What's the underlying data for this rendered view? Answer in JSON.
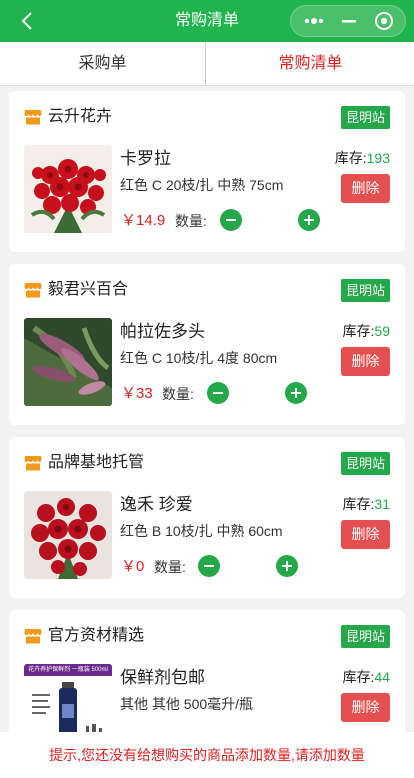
{
  "navbar": {
    "title": "常购清单",
    "background": "#21b34c"
  },
  "tabs": [
    {
      "label": "采购单",
      "active": false
    },
    {
      "label": "常购清单",
      "active": true
    }
  ],
  "labels": {
    "stock": "库存:",
    "delete": "删除",
    "qty": "数量:",
    "currency": "￥"
  },
  "items": [
    {
      "shop": "云升花卉",
      "station": "昆明站",
      "name": "卡罗拉",
      "spec": "红色 C 20枝/扎 中熟 75cm",
      "stock": "193",
      "price": "14.9",
      "image": "red-roses-bouquet"
    },
    {
      "shop": "毅君兴百合",
      "station": "昆明站",
      "name": "帕拉佐多头",
      "spec": "红色 C 10枝/扎 4度 80cm",
      "stock": "59",
      "price": "33",
      "image": "pink-lily-buds"
    },
    {
      "shop": "品牌基地托管",
      "station": "昆明站",
      "name": "逸禾 珍爱",
      "spec": "红色 B 10枝/扎 中熟 60cm",
      "stock": "31",
      "price": "0",
      "image": "red-roses-bouquet"
    },
    {
      "shop": "官方资材精选",
      "station": "昆明站",
      "name": "保鲜剂包邮",
      "spec": "其他 其他 500毫升/瓶",
      "stock": "44",
      "price": "",
      "image": "preservative-bottle"
    }
  ],
  "product_banner_text": "花卉养护保鲜剂 一瓶装 500ml",
  "tip": "提示,您还没有给想购买的商品添加数量,请添加数量",
  "colors": {
    "accent": "#24a84a",
    "price": "#e02020",
    "delete": "#e64f4f"
  }
}
